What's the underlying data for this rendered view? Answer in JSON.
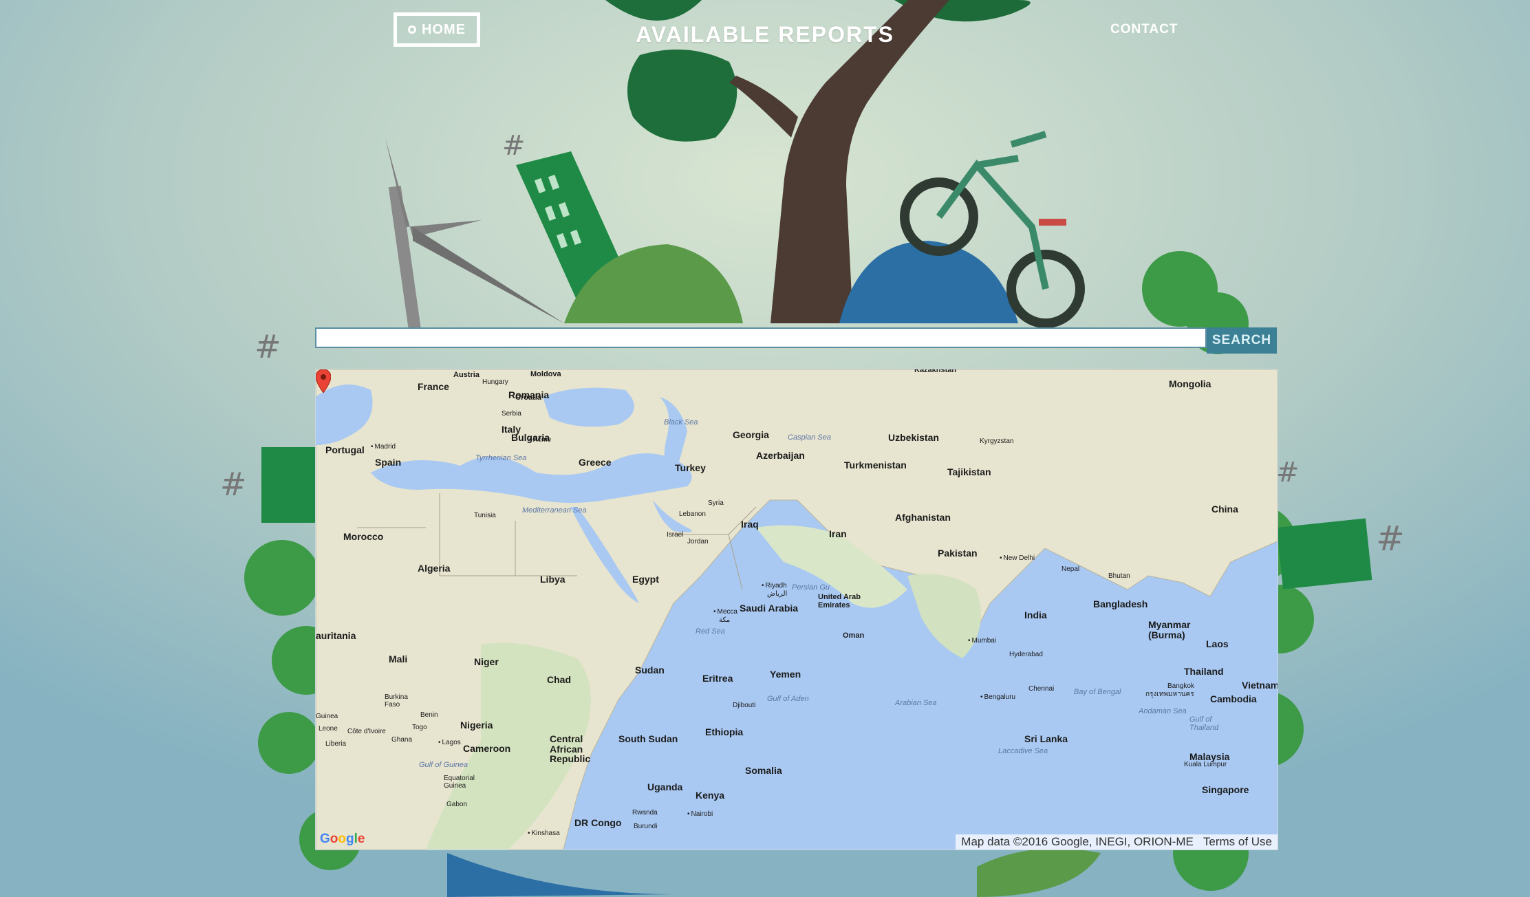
{
  "nav": {
    "home_label": "HOME",
    "title": "AVAILABLE REPORTS",
    "contact_label": "CONTACT"
  },
  "search": {
    "value": "",
    "button_label": "SEARCH"
  },
  "map": {
    "labels": {
      "austria": "Austria",
      "moldova": "Moldova",
      "hungary": "Hungary",
      "romania": "Romania",
      "france": "France",
      "croatia": "Croatia",
      "serbia": "Serbia",
      "italy": "Italy",
      "rome": "Rome",
      "bulgaria": "Bulgaria",
      "portugal": "Portugal",
      "madrid": "Madrid",
      "spain": "Spain",
      "greece": "Greece",
      "turkey": "Turkey",
      "georgia": "Georgia",
      "azerbaijan": "Azerbaijan",
      "uzbekistan": "Uzbekistan",
      "kyrgyzstan": "Kyrgyzstan",
      "turkmenistan": "Turkmenistan",
      "tajikistan": "Tajikistan",
      "kazakhstan": "Kazakhstan",
      "mongolia": "Mongolia",
      "china": "China",
      "afghanistan": "Afghanistan",
      "iran": "Iran",
      "iraq": "Iraq",
      "syria": "Syria",
      "lebanon": "Lebanon",
      "israel": "Israel",
      "jordan": "Jordan",
      "tunisia": "Tunisia",
      "morocco": "Morocco",
      "algeria": "Algeria",
      "libya": "Libya",
      "egypt": "Egypt",
      "saudi_arabia": "Saudi Arabia",
      "riyadh": "Riyadh",
      "riyadh_ar": "الرياض",
      "mecca": "Mecca",
      "mecca_ar": "مكة",
      "uae": "United Arab Emirates",
      "oman": "Oman",
      "yemen": "Yemen",
      "pakistan": "Pakistan",
      "new_delhi": "New Delhi",
      "nepal": "Nepal",
      "bhutan": "Bhutan",
      "bangladesh": "Bangladesh",
      "india": "India",
      "mumbai": "Mumbai",
      "hyderabad": "Hyderabad",
      "bengaluru": "Bengaluru",
      "chennai": "Chennai",
      "sri_lanka": "Sri Lanka",
      "myanmar": "Myanmar (Burma)",
      "laos": "Laos",
      "thailand": "Thailand",
      "vietnam": "Vietnam",
      "bangkok": "Bangkok",
      "bangkok_th": "กรุงเทพมหานคร",
      "cambodia": "Cambodia",
      "malaysia": "Malaysia",
      "kuala_lumpur": "Kuala Lumpur",
      "singapore": "Singapore",
      "mauritania": "auritania",
      "mali": "Mali",
      "niger": "Niger",
      "chad": "Chad",
      "sudan": "Sudan",
      "eritrea": "Eritrea",
      "djibouti": "Djibouti",
      "ethiopia": "Ethiopia",
      "south_sudan": "South Sudan",
      "somalia": "Somalia",
      "burkina_faso": "Burkina Faso",
      "guinea": "Guinea",
      "benin": "Benin",
      "togo": "Togo",
      "nigeria": "Nigeria",
      "cote_divoire": "Côte d'Ivoire",
      "ghana": "Ghana",
      "leone": "Leone",
      "liberia": "Liberia",
      "lagos": "Lagos",
      "cameroon": "Cameroon",
      "car": "Central African Republic",
      "equatorial_guinea": "Equatorial Guinea",
      "gabon": "Gabon",
      "uganda": "Uganda",
      "kenya": "Kenya",
      "rwanda": "Rwanda",
      "nairobi": "Nairobi",
      "burundi": "Burundi",
      "dr_congo": "DR Congo",
      "kinshasa": "Kinshasa"
    },
    "seas": {
      "black_sea": "Black Sea",
      "caspian_sea": "Caspian Sea",
      "tyrrhenian_sea": "Tyrrhenian Sea",
      "mediterranean_sea": "Mediterranean Sea",
      "persian_gulf": "Persian Gu",
      "red_sea": "Red Sea",
      "gulf_of_aden": "Gulf of Aden",
      "arabian_sea": "Arabian Sea",
      "bay_of_bengal": "Bay of Bengal",
      "andaman_sea": "Andaman Sea",
      "gulf_of_thailand": "Gulf of Thailand",
      "laccadive_sea": "Laccadive Sea",
      "gulf_of_guinea": "Gulf of Guinea"
    },
    "logo": "Google",
    "attribution": "Map data ©2016 Google, INEGI, ORION-ME",
    "terms": "Terms of Use",
    "marker": "red-map-pin"
  }
}
